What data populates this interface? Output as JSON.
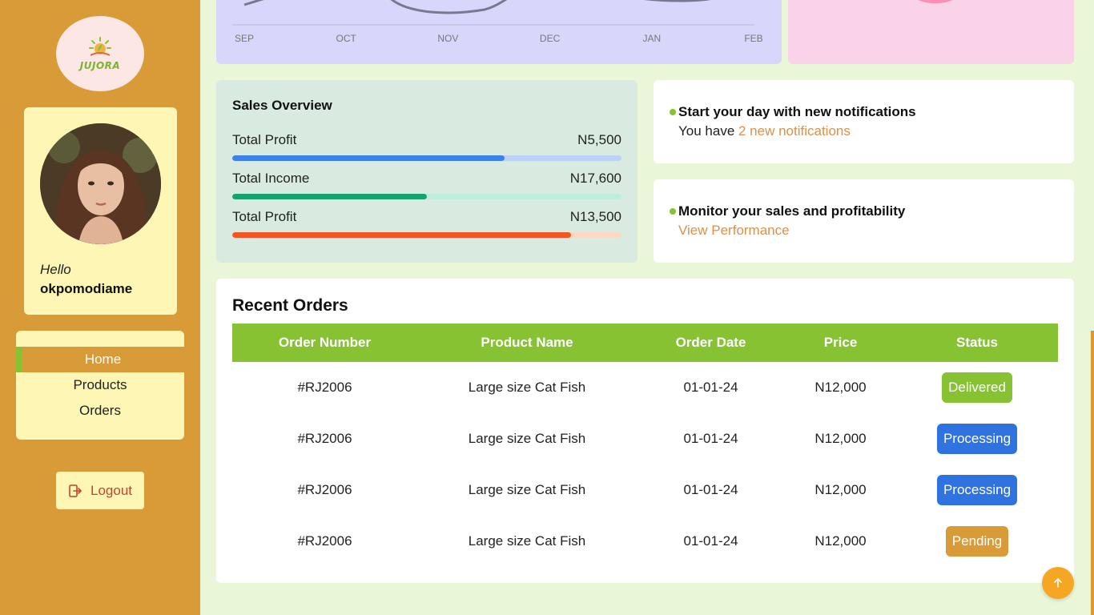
{
  "brand": {
    "name": "JUJORA"
  },
  "profile": {
    "greeting": "Hello",
    "username": "okpomodiame"
  },
  "nav": {
    "items": [
      {
        "label": "Home",
        "active": true
      },
      {
        "label": "Products",
        "active": false
      },
      {
        "label": "Orders",
        "active": false
      }
    ]
  },
  "logout": {
    "label": "Logout"
  },
  "chart_data": {
    "type": "line",
    "categories": [
      "SEP",
      "OCT",
      "NOV",
      "DEC",
      "JAN",
      "FEB"
    ],
    "title": "",
    "xlabel": "",
    "ylabel": ""
  },
  "sales": {
    "title": "Sales Overview",
    "metrics": [
      {
        "label": "Total Profit",
        "value": "N5,500",
        "fraction": 0.7,
        "color": "#3c82ea",
        "track": "#bcd3f7"
      },
      {
        "label": "Total Income",
        "value": "N17,600",
        "fraction": 0.5,
        "color": "#16a36e",
        "track": "#bdeedd"
      },
      {
        "label": "Total Profit",
        "value": "N13,500",
        "fraction": 0.87,
        "color": "#f25722",
        "track": "#fcd9c3"
      }
    ]
  },
  "notifications": [
    {
      "title": "Start your day with new notifications",
      "prefix": "You have ",
      "link": "2 new notifications"
    },
    {
      "title": "Monitor your sales and profitability",
      "prefix": "",
      "link": "View Performance"
    }
  ],
  "orders": {
    "title": "Recent Orders",
    "columns": [
      "Order Number",
      "Product Name",
      "Order Date",
      "Price",
      "Status"
    ],
    "rows": [
      {
        "order": "#RJ2006",
        "product": "Large size Cat Fish",
        "date": "01-01-24",
        "price": "N12,000",
        "status": "Delivered",
        "status_key": "delivered"
      },
      {
        "order": "#RJ2006",
        "product": "Large size Cat Fish",
        "date": "01-01-24",
        "price": "N12,000",
        "status": "Processing",
        "status_key": "processing"
      },
      {
        "order": "#RJ2006",
        "product": "Large size Cat Fish",
        "date": "01-01-24",
        "price": "N12,000",
        "status": "Processing",
        "status_key": "processing"
      },
      {
        "order": "#RJ2006",
        "product": "Large size Cat Fish",
        "date": "01-01-24",
        "price": "N12,000",
        "status": "Pending",
        "status_key": "pending"
      }
    ]
  },
  "colors": {
    "sidebar": "#d99a38",
    "accent_green": "#86c232",
    "background": "#e9f7d8",
    "link": "#d9914a"
  },
  "icons": {
    "logout": "logout-icon",
    "scroll_top": "arrow-up-icon"
  }
}
